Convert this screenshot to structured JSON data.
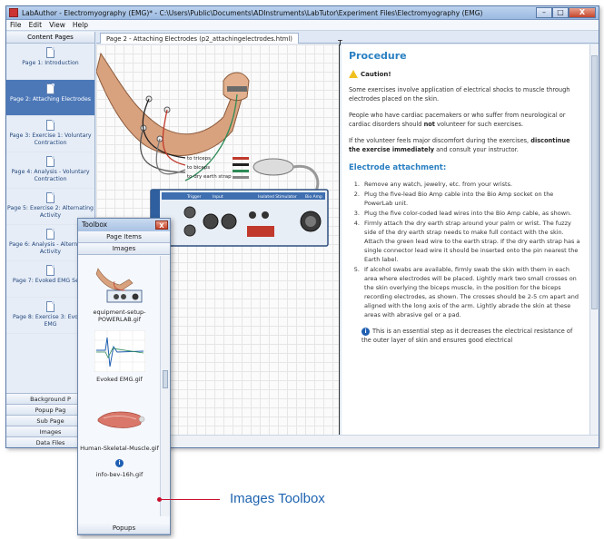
{
  "window": {
    "title": "LabAuthor - Electromyography (EMG)* - C:\\Users\\Public\\Documents\\ADInstruments\\LabTutor\\Experiment Files\\Electromyography (EMG)",
    "minimize": "–",
    "maximize": "□",
    "close": "X"
  },
  "menu": [
    "File",
    "Edit",
    "View",
    "Help"
  ],
  "content_pages": {
    "header": "Content Pages",
    "pages": [
      {
        "label": "Page 1: Introduction",
        "selected": false
      },
      {
        "label": "Page 2: Attaching Electrodes",
        "selected": true
      },
      {
        "label": "Page 3: Exercise 1: Voluntary Contraction",
        "selected": false
      },
      {
        "label": "Page 4: Analysis - Voluntary Contraction",
        "selected": false
      },
      {
        "label": "Page 5: Exercise 2: Alternating Activity",
        "selected": false
      },
      {
        "label": "Page 6: Analysis - Alternating Activity",
        "selected": false
      },
      {
        "label": "Page 7: Evoked EMG Setup",
        "selected": false
      },
      {
        "label": "Page 8: Exercise 3: Evoked EMG",
        "selected": false
      }
    ],
    "bottom_tabs": [
      "Background P",
      "Popup Pag",
      "Sub Page",
      "Images",
      "Data Files"
    ]
  },
  "document_tab": "Page 2 - Attaching Electrodes (p2_attachingelectrodes.html)",
  "diagram": {
    "wire_labels": [
      "to triceps",
      "to biceps",
      "to dry earth strap"
    ],
    "device_labels": [
      "Trigger",
      "Input",
      "Isolated Stimulator",
      "Bio Amp"
    ]
  },
  "procedure": {
    "title": "Procedure",
    "caution": "Caution!",
    "para1": "Some exercises involve application of electrical shocks to muscle through electrodes placed on the skin.",
    "para2_a": "People who have cardiac pacemakers or who suffer from neurological or cardiac disorders should ",
    "para2_b": "not",
    "para2_c": " volunteer for such exercises.",
    "para3_a": "If the volunteer feels major discomfort during the exercises, ",
    "para3_b": "discontinue the exercise immediately",
    "para3_c": " and consult your instructor.",
    "electrode_title": "Electrode attachment:",
    "steps": [
      "Remove any watch, jewelry, etc. from your wrists.",
      "Plug the five-lead Bio Amp cable into the Bio Amp socket on the PowerLab unit.",
      "Plug the five color-coded lead wires into the Bio Amp cable, as shown.",
      "Firmly attach the dry earth strap around your palm or wrist. The fuzzy side of the dry earth strap needs to make full contact with the skin. Attach the green lead wire to the earth strap. If the dry earth strap has a single connector lead wire it should be inserted onto the pin nearest the Earth label.",
      "If alcohol swabs are available, firmly swab the skin with them in each area where electrodes will be placed. Lightly mark two small crosses on the skin overlying the biceps muscle, in the position for the biceps recording electrodes, as shown. The crosses should be 2-5 cm apart and aligned with the long axis of the arm. Lightly abrade the skin at these areas with abrasive gel or a pad."
    ],
    "info_note": "This is an essential step as it decreases the electrical resistance of the outer layer of skin and ensures good electrical"
  },
  "toolbox": {
    "title": "Toolbox",
    "close": "X",
    "sections": [
      "Page Items",
      "Images"
    ],
    "items": [
      {
        "name": "equipment-setup-POWERLAB.gif"
      },
      {
        "name": "Evoked EMG.gif"
      },
      {
        "name": "Human-Skeletal-Muscle.gif"
      },
      {
        "name": "info-bev-16h.gif"
      }
    ],
    "footer": "Popups"
  },
  "callout": {
    "label": "Images Toolbox",
    "color": "#c8102e",
    "label_color": "#1e63b0"
  }
}
